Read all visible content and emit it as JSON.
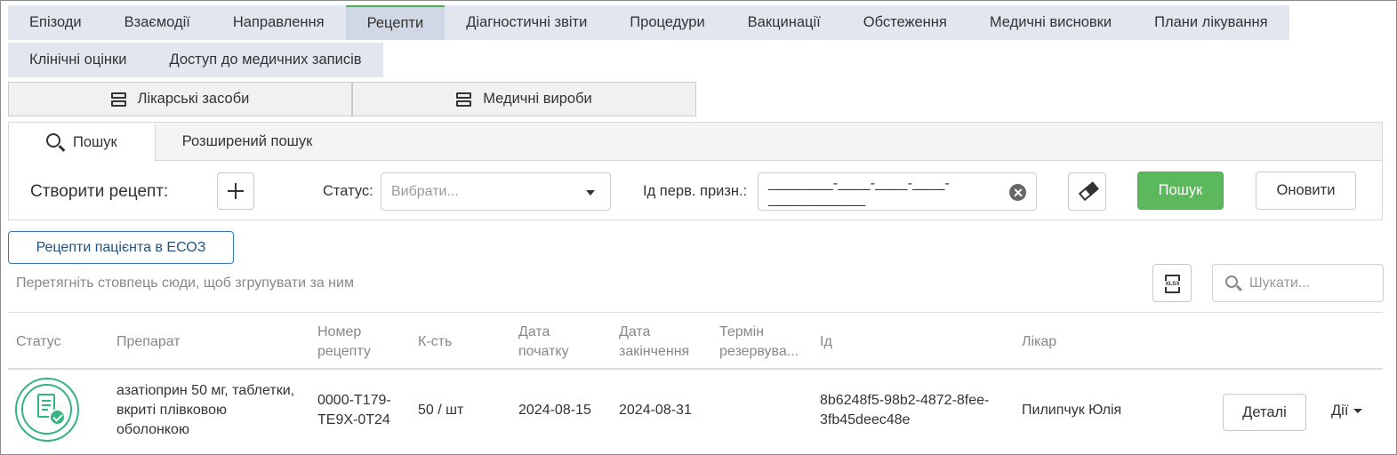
{
  "top_tabs": {
    "row1": [
      "Епізоди",
      "Взаємодії",
      "Направлення",
      "Рецепти",
      "Діагностичні звіти",
      "Процедури",
      "Вакцинації",
      "Обстеження",
      "Медичні висновки",
      "Плани лікування"
    ],
    "row2": [
      "Клінічні оцінки",
      "Доступ до медичних записів"
    ],
    "active": "Рецепти"
  },
  "sub_tabs": {
    "drugs": "Лікарські засоби",
    "devices": "Медичні вироби"
  },
  "search_tabs": {
    "search": "Пошук",
    "advanced": "Розширений пошук"
  },
  "search_form": {
    "create_label": "Створити рецепт:",
    "status_label": "Статус:",
    "status_placeholder": "Вибрати...",
    "id_label": "Ід перв. призн.:",
    "id_value": "________-____-____-____-____________",
    "search_button": "Пошук",
    "refresh_button": "Оновити"
  },
  "ehr_button": "Рецепти пацієнта в ЕСОЗ",
  "grid_toolbar": {
    "group_hint": "Перетягніть стовпець сюди, щоб згрупувати за ним",
    "xlsx_label": "XLSX",
    "search_placeholder": "Шукати..."
  },
  "table": {
    "headers": {
      "status": "Статус",
      "drug": "Препарат",
      "number_1": "Номер",
      "number_2": "рецепту",
      "qty": "К-сть",
      "start_1": "Дата",
      "start_2": "початку",
      "end_1": "Дата",
      "end_2": "закінчення",
      "reserve_1": "Термін",
      "reserve_2": "резервува...",
      "id": "Ід",
      "doctor": "Лікар"
    },
    "rows": [
      {
        "drug_1": "азатіоприн 50 мг, таблетки,",
        "drug_2": "вкриті плівковою",
        "drug_3": "оболонкою",
        "number_1": "0000-T179-",
        "number_2": "TE9X-0T24",
        "qty": "50 / шт",
        "start": "2024-08-15",
        "end": "2024-08-31",
        "reserve": "",
        "id_1": "8b6248f5-98b2-4872-8fee-",
        "id_2": "3fb45deec48e",
        "doctor": "Пилипчук Юлія",
        "details": "Деталі",
        "actions": "Дії"
      }
    ]
  },
  "colors": {
    "accent_green": "#5cb85c",
    "status_green": "#36b37e",
    "link_blue": "#337ab7",
    "tab_bg": "#e2e6ef"
  }
}
